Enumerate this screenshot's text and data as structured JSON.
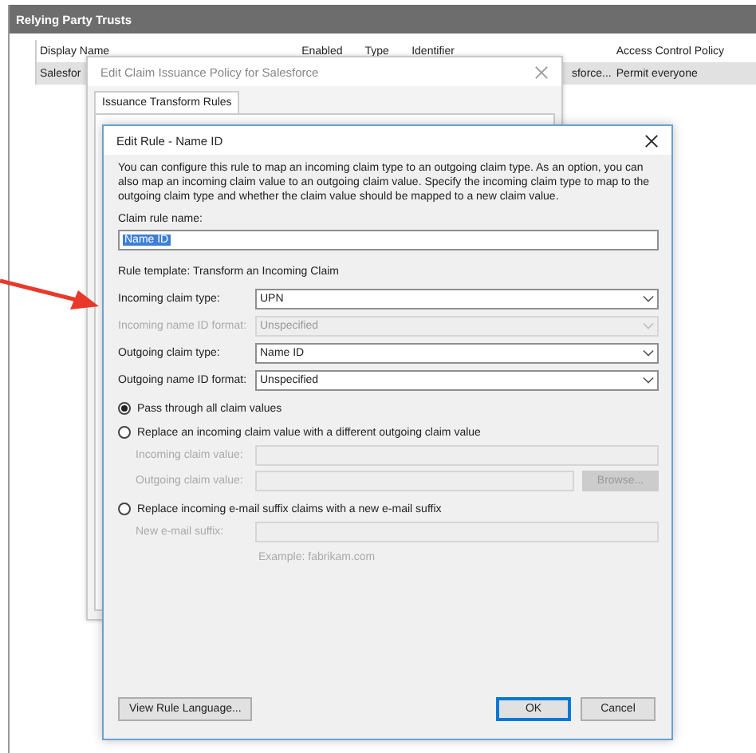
{
  "panel": {
    "title": "Relying Party Trusts",
    "columns": [
      "Display Name",
      "Enabled",
      "Type",
      "Identifier",
      "Access Control Policy"
    ],
    "rows": [
      {
        "display_name": "Salesfor",
        "identifier": "sforce...",
        "access_control_policy": "Permit everyone",
        "selected": true
      }
    ]
  },
  "policy_dialog": {
    "title": "Edit Claim Issuance Policy for Salesforce",
    "tabs": [
      {
        "label": "Issuance Transform Rules",
        "selected": true
      }
    ]
  },
  "rule_dialog": {
    "title": "Edit Rule - Name ID",
    "description": "You can configure this rule to map an incoming claim type to an outgoing claim type. As an option, you can also map an incoming claim value to an outgoing claim value. Specify the incoming claim type to map to the outgoing claim type and whether the claim value should be mapped to a new claim value.",
    "name_label": "Claim rule name:",
    "name_value": "Name ID",
    "name_value_selected": true,
    "template": "Rule template: Transform an Incoming Claim",
    "fields": [
      {
        "label": "Incoming claim type:",
        "value": "UPN",
        "disabled": false
      },
      {
        "label": "Incoming name ID format:",
        "value": "Unspecified",
        "disabled": true
      },
      {
        "label": "Outgoing claim type:",
        "value": "Name ID",
        "disabled": false
      },
      {
        "label": "Outgoing name ID format:",
        "value": "Unspecified",
        "disabled": false
      }
    ],
    "options": [
      {
        "label": "Pass through all claim values",
        "selected": true
      },
      {
        "label": "Replace an incoming claim value with a different outgoing claim value",
        "selected": false,
        "fields": [
          {
            "label": "Incoming claim value:",
            "disabled": true
          },
          {
            "label": "Outgoing claim value:",
            "disabled": true,
            "button": {
              "label": "Browse...",
              "disabled": true
            }
          }
        ]
      },
      {
        "label": "Replace incoming e-mail suffix claims with a new e-mail suffix",
        "selected": false,
        "fields": [
          {
            "label": "New e-mail suffix:",
            "disabled": true,
            "hint": "Example: fabrikam.com"
          }
        ]
      }
    ],
    "buttons": [
      {
        "label": "View Rule Language...",
        "kind": "left"
      },
      {
        "label": "OK",
        "kind": "default"
      },
      {
        "label": "Cancel",
        "kind": "normal"
      }
    ]
  }
}
